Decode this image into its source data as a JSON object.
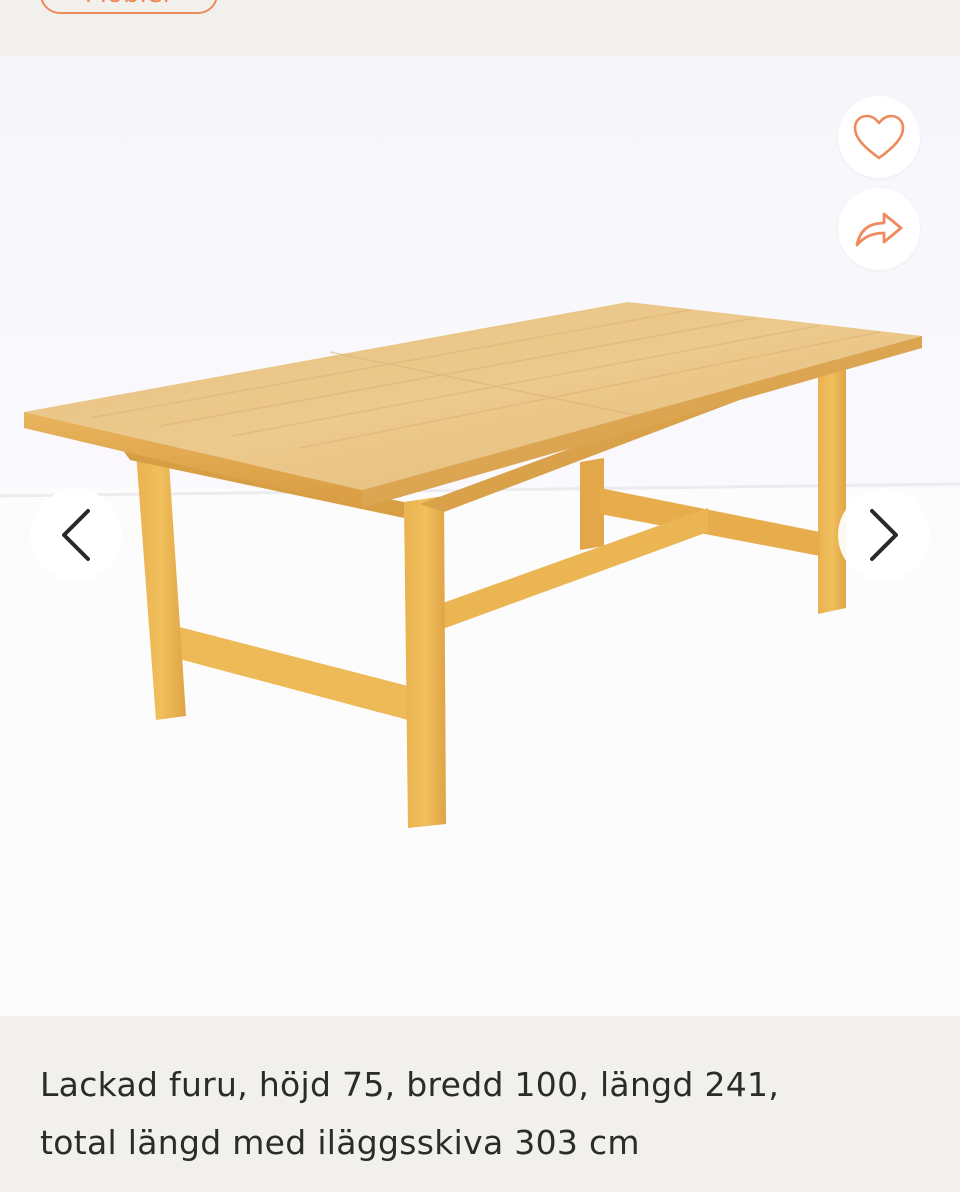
{
  "category": {
    "label": "Möbler"
  },
  "gallery": {
    "image_alt": "Lackad furu matbord",
    "favorite_icon": "heart-icon",
    "share_icon": "share-arrow-icon",
    "prev_icon": "chevron-left-icon",
    "next_icon": "chevron-right-icon",
    "accent_color": "#ee8a5c"
  },
  "product": {
    "description_line1": "Lackad furu, höjd 75, bredd 100, längd 241,",
    "description_line2": "total längd med iläggsskiva 303 cm"
  }
}
